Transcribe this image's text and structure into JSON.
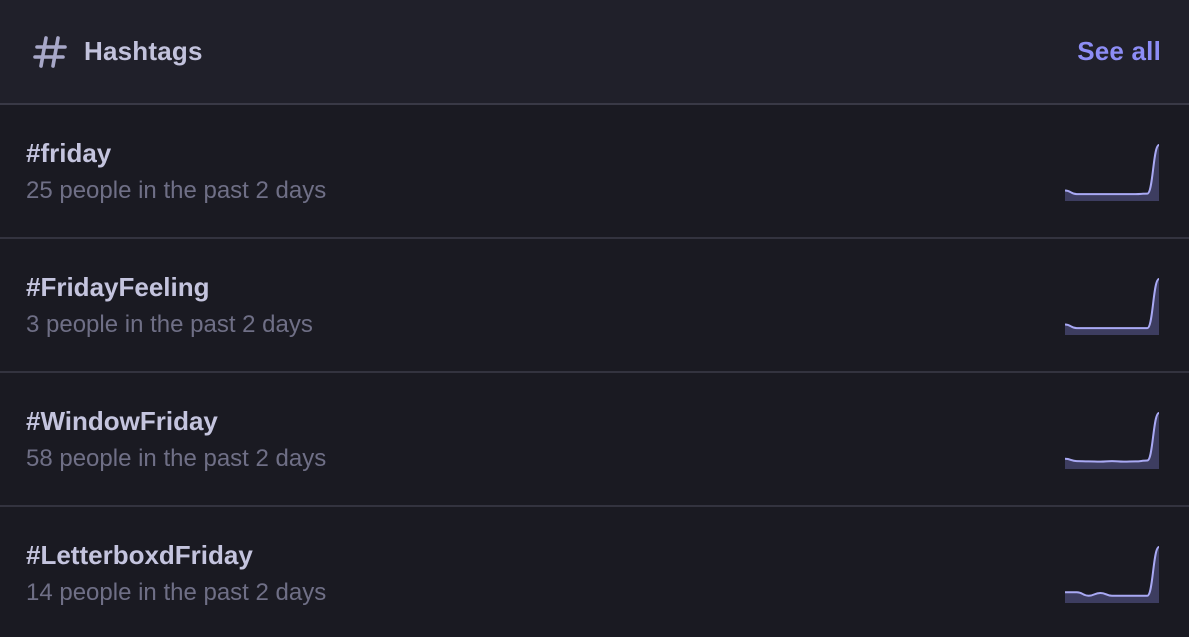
{
  "header": {
    "icon": "hash-icon",
    "title": "Hashtags",
    "see_all_label": "See all"
  },
  "colors": {
    "accent": "#8d8df5",
    "spark_line": "#a9a9f4",
    "spark_fill": "#3d3d60"
  },
  "hashtags": [
    {
      "tag": "#friday",
      "usage": "25 people in the past 2 days",
      "trend": [
        0.72,
        0.42,
        0.42,
        0.42,
        0.42,
        0.42,
        0.42,
        0.46,
        4.6
      ]
    },
    {
      "tag": "#FridayFeeling",
      "usage": "3 people in the past 2 days",
      "trend": [
        0.72,
        0.42,
        0.42,
        0.42,
        0.42,
        0.42,
        0.42,
        0.42,
        4.6
      ]
    },
    {
      "tag": "#WindowFriday",
      "usage": "58 people in the past 2 days",
      "trend": [
        0.7,
        0.5,
        0.48,
        0.46,
        0.5,
        0.46,
        0.48,
        0.55,
        4.6
      ]
    },
    {
      "tag": "#LetterboxdFriday",
      "usage": "14 people in the past 2 days",
      "trend": [
        0.75,
        0.75,
        0.45,
        0.68,
        0.45,
        0.45,
        0.45,
        0.45,
        4.6
      ]
    }
  ]
}
